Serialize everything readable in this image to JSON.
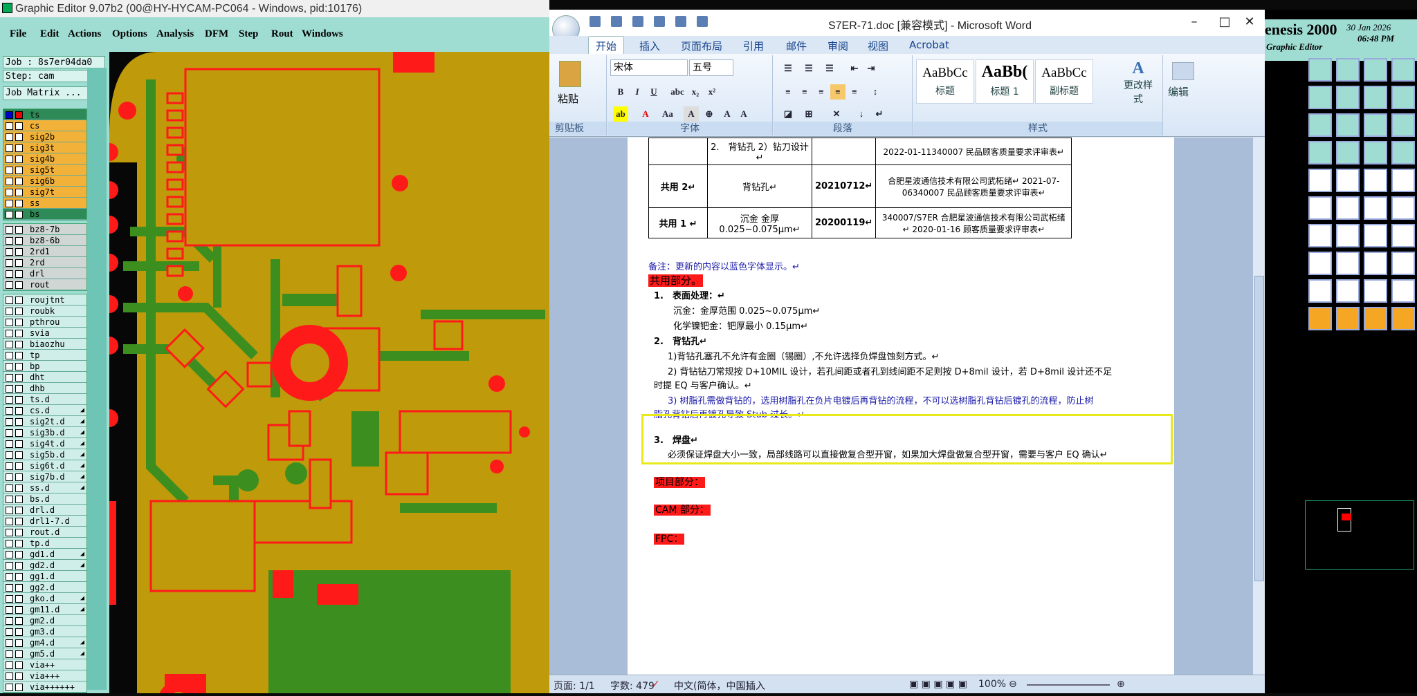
{
  "genesis": {
    "title": "Graphic Editor 9.07b2 (00@HY-HYCAM-PC064 - Windows, pid:10176)",
    "menu": [
      "File",
      "Edit",
      "Actions",
      "Options",
      "Analysis",
      "DFM",
      "Step",
      "Rout",
      "Windows"
    ],
    "job": "Job : 8s7er04da0",
    "step": "Step: cam",
    "job_matrix": "Job Matrix ...",
    "layer_groups": [
      {
        "kind": "signal",
        "layers": [
          {
            "name": "ts",
            "color": "c-ts",
            "sel": true
          },
          {
            "name": "cs",
            "color": "c-sig"
          },
          {
            "name": "sig2b",
            "color": "c-sig"
          },
          {
            "name": "sig3t",
            "color": "c-sig"
          },
          {
            "name": "sig4b",
            "color": "c-sig"
          },
          {
            "name": "sig5t",
            "color": "c-sig"
          },
          {
            "name": "sig6b",
            "color": "c-sig"
          },
          {
            "name": "sig7t",
            "color": "c-sig"
          },
          {
            "name": "ss",
            "color": "c-ss"
          },
          {
            "name": "bs",
            "color": "c-bs"
          }
        ]
      },
      {
        "kind": "drill",
        "layers": [
          {
            "name": "bz8-7b",
            "color": "c-drl"
          },
          {
            "name": "bz8-6b",
            "color": "c-drl"
          },
          {
            "name": "2rd1",
            "color": "c-drl"
          },
          {
            "name": "2rd",
            "color": "c-drl"
          },
          {
            "name": "drl",
            "color": "c-drl"
          },
          {
            "name": "rout",
            "color": "c-drl"
          }
        ]
      },
      {
        "kind": "misc",
        "layers": [
          {
            "name": "roujtnt"
          },
          {
            "name": "roubk"
          },
          {
            "name": "pthrou"
          },
          {
            "name": "svia"
          },
          {
            "name": "biaozhu"
          },
          {
            "name": "tp"
          },
          {
            "name": "bp"
          },
          {
            "name": "dht"
          },
          {
            "name": "dhb"
          },
          {
            "name": "ts.d"
          },
          {
            "name": "cs.d",
            "arr": true
          },
          {
            "name": "sig2t.d",
            "arr": true
          },
          {
            "name": "sig3b.d",
            "arr": true
          },
          {
            "name": "sig4t.d",
            "arr": true
          },
          {
            "name": "sig5b.d",
            "arr": true
          },
          {
            "name": "sig6t.d",
            "arr": true
          },
          {
            "name": "sig7b.d",
            "arr": true
          },
          {
            "name": "ss.d",
            "arr": true
          },
          {
            "name": "bs.d"
          },
          {
            "name": "drl.d"
          },
          {
            "name": "drl1-7.d"
          },
          {
            "name": "rout.d"
          },
          {
            "name": "tp.d"
          },
          {
            "name": "gd1.d",
            "arr": true
          },
          {
            "name": "gd2.d",
            "arr": true
          },
          {
            "name": "gg1.d"
          },
          {
            "name": "gg2.d"
          },
          {
            "name": "gko.d",
            "arr": true
          },
          {
            "name": "gm11.d",
            "arr": true
          },
          {
            "name": "gm2.d"
          },
          {
            "name": "gm3.d"
          },
          {
            "name": "gm4.d",
            "arr": true
          },
          {
            "name": "gm5.d",
            "arr": true
          },
          {
            "name": "via++"
          },
          {
            "name": "via+++"
          },
          {
            "name": "via++++++"
          }
        ]
      }
    ],
    "right_title": "enesis 2000",
    "right_subtitle": "Graphic Editor",
    "date": "30 Jan 2026",
    "time": "06:48 PM"
  },
  "word": {
    "title": "S7ER-71.doc [兼容模式] - Microsoft Word",
    "tabs": [
      "开始",
      "插入",
      "页面布局",
      "引用",
      "邮件",
      "审阅",
      "视图",
      "Acrobat"
    ],
    "ribbon": {
      "paste": "粘贴",
      "clipboard": "剪贴板",
      "font_name": "宋体",
      "font_size": "五号",
      "font_group": "字体",
      "para_group": "段落",
      "styles": [
        {
          "preview": "AaBbCc",
          "name": "标题"
        },
        {
          "preview": "AaBb(",
          "name": "标题 1"
        },
        {
          "preview": "AaBbCc",
          "name": "副标题"
        }
      ],
      "change_styles": "更改样式",
      "styles_group": "样式",
      "edit": "编辑"
    },
    "table": {
      "rows": [
        {
          "a": "",
          "b": "2.　背钻孔 2）钻刀设计↵",
          "c": "",
          "d": "2022-01-11340007 民品顾客质量要求评审表↵"
        },
        {
          "a": "共用 2↵",
          "b": "背钻孔↵",
          "c": "20210712↵",
          "d": "合肥星波通信技术有限公司武柘绪↵ 2021-07-06340007 民品顾客质量要求评审表↵"
        },
        {
          "a": "共用 1 ↵",
          "b": "沉金 金厚 0.025~0.075μm↵",
          "c": "20200119↵",
          "d": "340007/S7ER 合肥星波通信技术有限公司武柘绪↵ 2020-01-16 顾客质量要求评审表↵"
        }
      ]
    },
    "lines": {
      "note": "备注：更新的内容以蓝色字体显示。↵",
      "shared": "共用部分。",
      "s1_head": "1.　表面处理：↵",
      "s1_a": "沉金：金厚范围 0.025~0.075μm↵",
      "s1_b": "化学镍钯金：钯厚最小 0.15μm↵",
      "s2_head": "2.　背钻孔↵",
      "s2_a": "1)背钻孔塞孔不允许有金圈（锡圈）,不允许选择负焊盘蚀刻方式。↵",
      "s2_b1": "2) 背钻钻刀常规按 D+10MIL 设计，若孔间距或者孔到线间距不足则按 D+8mil 设计，若 D+8mil 设计还不足",
      "s2_b2": "时提 EQ 与客户确认。↵",
      "s2_c1": "3) 树脂孔需做背钻的，选用树脂孔在负片电镀后再背钻的流程，不可以选树脂孔背钻后镀孔的流程，防止树",
      "s2_c2": "脂孔背钻后再镀孔导致 Stub 过长。↵",
      "s3_head": "3.　焊盘↵",
      "s3_a": "必须保证焊盘大小一致，局部线路可以直接做复合型开窗，如果加大焊盘做复合型开窗，需要与客户 EQ 确认↵",
      "pm": "项目部分：",
      "cam": "CAM 部分：",
      "fpc": "FPC："
    },
    "status": {
      "page": "页面: 1/1",
      "words": "字数: 479",
      "lang": "中文(简体，中国)",
      "mode": "插入",
      "zoom": "100%"
    }
  }
}
